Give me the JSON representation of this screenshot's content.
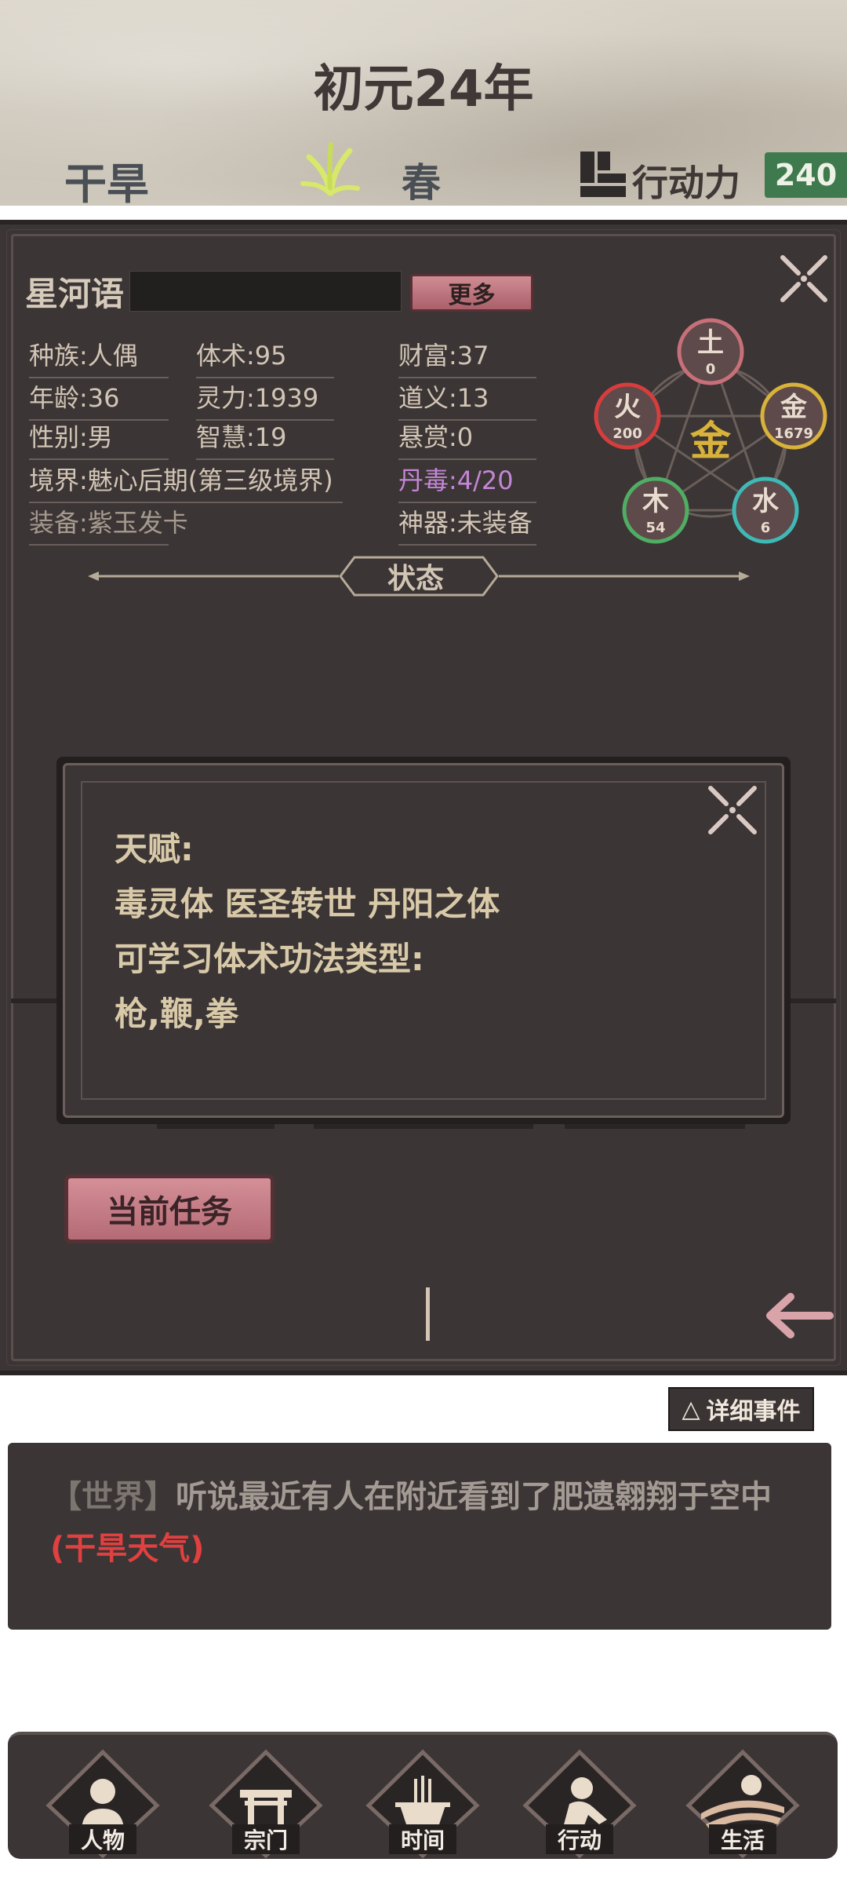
{
  "header": {
    "year": "初元24年",
    "weather": "干旱",
    "season": "春",
    "action_label": "行动力",
    "action_value": "240"
  },
  "character": {
    "name": "星河语",
    "more_button": "更多",
    "stats_col1": [
      "种族:人偶",
      "年龄:36",
      "性别:男",
      "境界:魅心后期(第三级境界)",
      "装备:紫玉发卡"
    ],
    "stats_col2": [
      "体术:95",
      "灵力:1939",
      "智慧:19"
    ],
    "stats_col3": [
      "财富:37",
      "道义:13",
      "悬赏:0",
      "丹毒:4/20",
      "神器:未装备"
    ]
  },
  "elements": {
    "center": "金",
    "earth": {
      "name": "土",
      "value": "0",
      "color": "#c8707a"
    },
    "fire": {
      "name": "火",
      "value": "200",
      "color": "#d83d3d"
    },
    "metal": {
      "name": "金",
      "value": "1679",
      "color": "#d8b23a"
    },
    "wood": {
      "name": "木",
      "value": "54",
      "color": "#4fae63"
    },
    "water": {
      "name": "水",
      "value": "6",
      "color": "#3fb9b6"
    }
  },
  "status_label": "状态",
  "dialog": {
    "talent_title": "天赋:",
    "talents": "毒灵体  医圣转世  丹阳之体",
    "skill_title": "可学习体术功法类型:",
    "skills": "枪,鞭,拳"
  },
  "task_button": "当前任务",
  "events": {
    "detail_button": "详细事件",
    "detail_icon": "△",
    "world_tag": "【世界】",
    "message": "听说最近有人在附近看到了肥遗翱翔于空中",
    "weather_tag": "(干旱天气)"
  },
  "nav": [
    "人物",
    "宗门",
    "时间",
    "行动",
    "生活"
  ],
  "colors": {
    "accent_pink": "#c47a83",
    "green_badge": "#3e7a4d",
    "panel": "#3b3535",
    "warning_red": "#e04040",
    "dan_poison": "#c486d6"
  }
}
